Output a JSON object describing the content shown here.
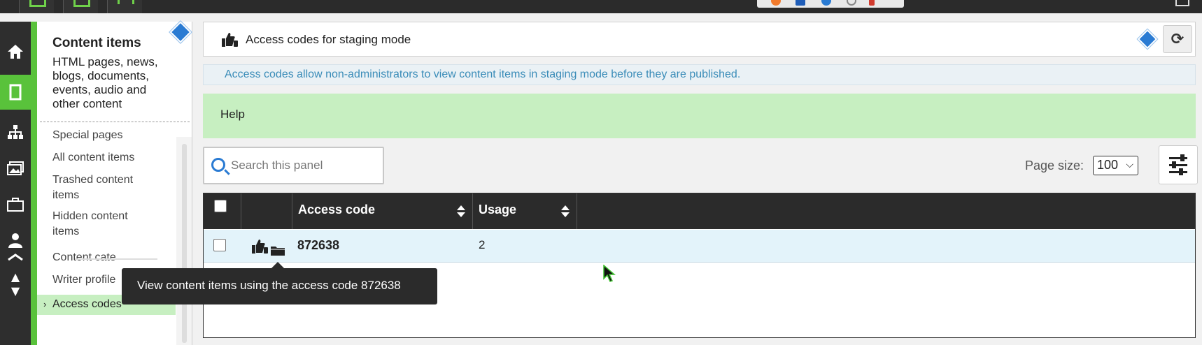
{
  "topbar": {
    "icons": [
      "dashboard-icon",
      "content-icon",
      "window-icon"
    ],
    "browser_extension_colors": [
      "#f07a2c",
      "#1f5db8",
      "#2a7bd3",
      "#888888",
      "#d13b2e"
    ]
  },
  "rail": {
    "items": [
      {
        "icon": "home-icon",
        "glyph": "⌂",
        "active": false
      },
      {
        "icon": "content-items-icon",
        "glyph": "▯",
        "active": true
      },
      {
        "icon": "sitemap-icon",
        "glyph": "⚯",
        "active": false
      },
      {
        "icon": "media-icon",
        "glyph": "▦",
        "active": false
      },
      {
        "icon": "briefcase-icon",
        "glyph": "▭",
        "active": false
      },
      {
        "icon": "user-icon",
        "glyph": "●",
        "active": false
      },
      {
        "icon": "mail-icon",
        "glyph": "✉",
        "active": false
      },
      {
        "icon": "scroll-arrows-icon",
        "glyph": "▲▼",
        "active": false
      }
    ],
    "accent_color": "#59c23b"
  },
  "sidebar": {
    "title": "Content items",
    "description": "HTML pages, news, blogs, documents, events, audio and other content",
    "nav": [
      {
        "label": "Special pages"
      },
      {
        "label": "All content items"
      },
      {
        "label": "Trashed content items"
      },
      {
        "label": "Hidden content items"
      },
      {
        "label": "Content cate"
      },
      {
        "label": "Writer profile"
      },
      {
        "label": "Access codes",
        "active": true
      }
    ]
  },
  "panel": {
    "title": "Access codes for staging mode",
    "info": "Access codes allow non-administrators to view content items in staging mode before they are published.",
    "help_label": "Help",
    "search_placeholder": "Search this panel",
    "page_size_label": "Page size:",
    "page_size_value": "100"
  },
  "table": {
    "columns": [
      "",
      "",
      "Access code",
      "Usage"
    ],
    "rows": [
      {
        "access_code": "872638",
        "usage": "2"
      }
    ]
  },
  "tooltip": {
    "text": "View content items using the access code 872638"
  },
  "colors": {
    "accent_green": "#59c23b",
    "light_green": "#c7efc1",
    "info_blue_text": "#3a8cb8",
    "dark_header": "#2b2b2b",
    "row_highlight": "#e3f3fa"
  }
}
